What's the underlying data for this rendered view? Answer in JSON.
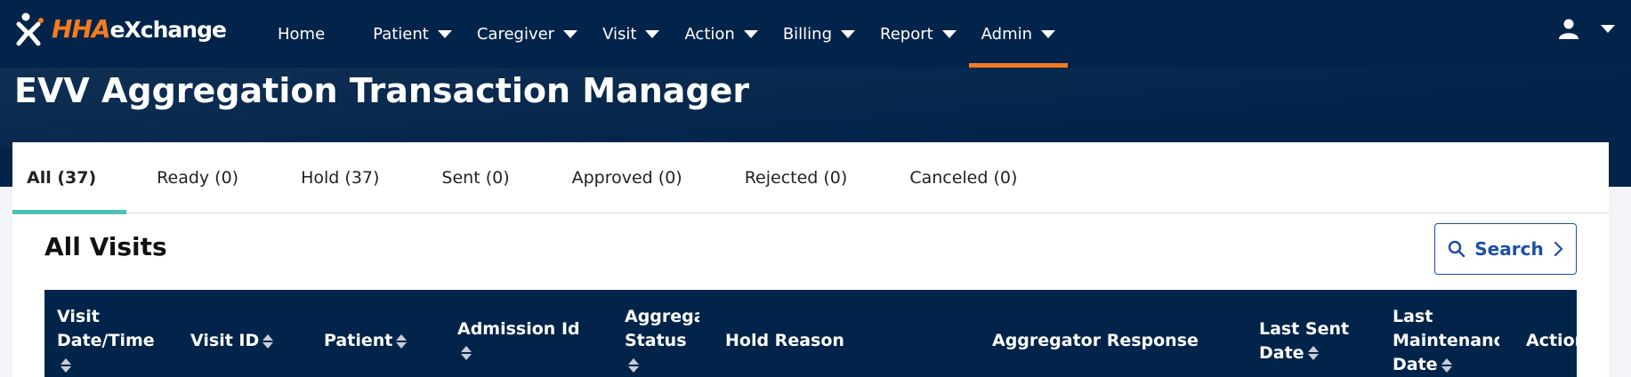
{
  "brand": {
    "logo_hha": "HHA",
    "logo_exchange": "eXchange",
    "accent": "#f47b20",
    "navy": "#03244a",
    "tab_accent": "#4ec1b6",
    "link_blue": "#1d4fa1"
  },
  "nav": {
    "items": [
      {
        "label": "Home"
      },
      {
        "label": "Patient"
      },
      {
        "label": "Caregiver"
      },
      {
        "label": "Visit"
      },
      {
        "label": "Action"
      },
      {
        "label": "Billing"
      },
      {
        "label": "Report"
      },
      {
        "label": "Admin"
      }
    ],
    "user_icon": "user-icon"
  },
  "page": {
    "title": "EVV Aggregation Transaction Manager"
  },
  "tabs": [
    {
      "label": "All (37)"
    },
    {
      "label": "Ready (0)"
    },
    {
      "label": "Hold (37)"
    },
    {
      "label": "Sent (0)"
    },
    {
      "label": "Approved (0)"
    },
    {
      "label": "Rejected (0)"
    },
    {
      "label": "Canceled (0)"
    }
  ],
  "section": {
    "title": "All Visits",
    "search_label": "Search"
  },
  "table": {
    "columns": [
      {
        "line1": "Visit",
        "line2": "Date/Time"
      },
      {
        "line1": "Visit ID"
      },
      {
        "line1": "Patient"
      },
      {
        "line1": "Admission Id"
      },
      {
        "line1": "Aggrega",
        "line2": "Status"
      },
      {
        "line1": "Hold Reason"
      },
      {
        "line1": "Aggregator Response"
      },
      {
        "line1": "Last Sent",
        "line2": "Date"
      },
      {
        "line1": "Last",
        "line2": "Maintenance",
        "line3": "Date"
      },
      {
        "line1": "Action"
      }
    ]
  }
}
